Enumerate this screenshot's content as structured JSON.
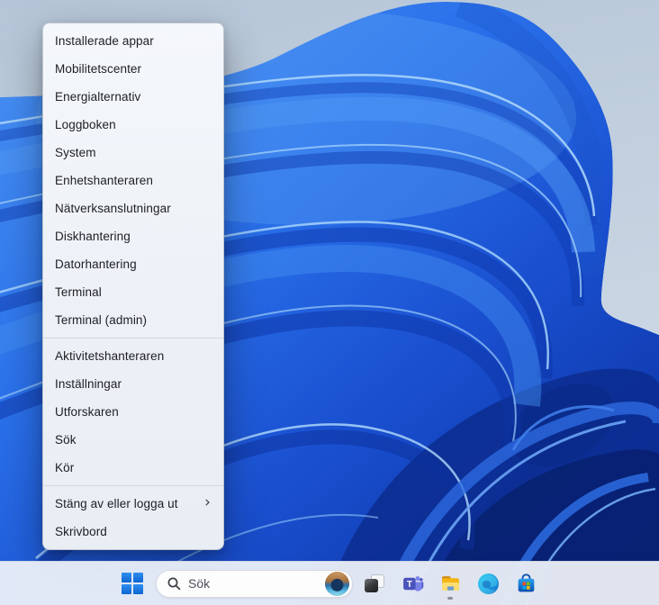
{
  "desktop": {
    "wallpaper_name": "windows-11-bloom",
    "colors": {
      "background_top": "#b5c5d7",
      "background_bottom": "#d0dbe7",
      "bloom_bright": "#4c95f5",
      "bloom_mid": "#2a70ea",
      "bloom_dark": "#0a2f9e",
      "bloom_navy_shadow": "#08206e",
      "petal_highlight": "#a8d4fb"
    }
  },
  "menu": {
    "name": "win-x-quick-link-menu",
    "submenu_indicator": "›",
    "groups": [
      [
        "Installerade appar",
        "Mobilitetscenter",
        "Energialternativ",
        "Loggboken",
        "System",
        "Enhetshanteraren",
        "Nätverksanslutningar",
        "Diskhantering",
        "Datorhantering",
        "Terminal",
        "Terminal (admin)"
      ],
      [
        "Aktivitetshanteraren",
        "Inställningar",
        "Utforskaren",
        "Sök",
        "Kör"
      ],
      [
        {
          "label": "Stäng av eller logga ut",
          "submenu": true
        },
        "Skrivbord"
      ]
    ]
  },
  "taskbar": {
    "colors": {
      "taskbar_bg": "#f0f3f9",
      "accent_blue": "#1573e6"
    },
    "start": {
      "icon": "windows-logo-icon"
    },
    "search": {
      "placeholder": "Sök",
      "icons": [
        "magnifier-icon",
        "bing-daily-image-avatar"
      ]
    },
    "teams_glyph": "T",
    "buttons": [
      {
        "icon": "task-view-icon",
        "running": false
      },
      {
        "icon": "teams-icon",
        "running": false
      },
      {
        "icon": "file-explorer-icon",
        "running": true
      },
      {
        "icon": "edge-icon",
        "running": false
      },
      {
        "icon": "microsoft-store-icon",
        "running": false
      }
    ]
  }
}
